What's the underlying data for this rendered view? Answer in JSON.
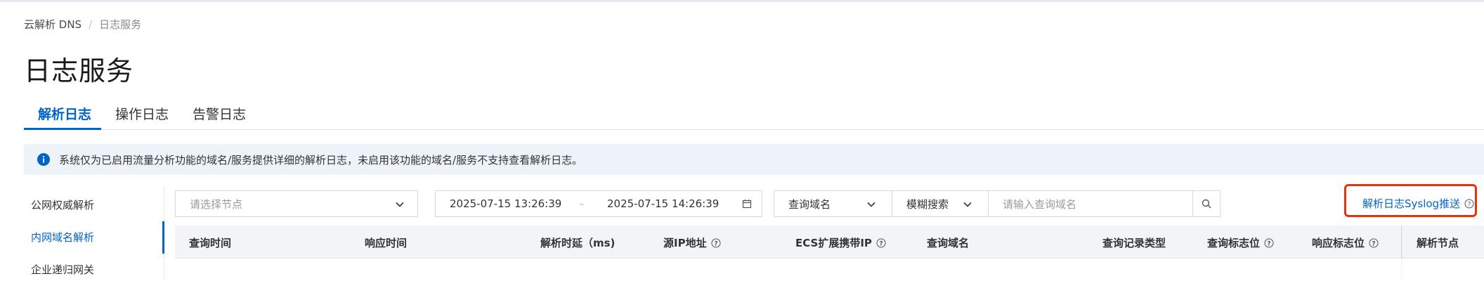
{
  "breadcrumb": {
    "root": "云解析 DNS",
    "separator": "/",
    "current": "日志服务"
  },
  "page": {
    "title": "日志服务"
  },
  "tabs": [
    {
      "label": "解析日志",
      "active": true
    },
    {
      "label": "操作日志",
      "active": false
    },
    {
      "label": "告警日志",
      "active": false
    }
  ],
  "notice": {
    "icon": "info-circle-icon",
    "text": "系统仅为已启用流量分析功能的域名/服务提供详细的解析日志，未启用该功能的域名/服务不支持查看解析日志。"
  },
  "sidebar": {
    "items": [
      {
        "label": "公网权威解析",
        "active": false
      },
      {
        "label": "内网域名解析",
        "active": true
      },
      {
        "label": "企业递归网关",
        "active": false
      }
    ]
  },
  "filters": {
    "node_select": {
      "placeholder": "请选择节点"
    },
    "date_range": {
      "start": "2025-07-15 13:26:39",
      "end": "2025-07-15 14:26:39"
    },
    "field_select": {
      "value": "查询域名"
    },
    "match_select": {
      "value": "模糊搜索"
    },
    "search_input": {
      "placeholder": "请输入查询域名"
    }
  },
  "syslog_link": {
    "label": "解析日志Syslog推送"
  },
  "table": {
    "columns": [
      {
        "label": "查询时间",
        "help": false
      },
      {
        "label": "响应时间",
        "help": false
      },
      {
        "label": "解析时延（ms)",
        "help": false
      },
      {
        "label": "源IP地址",
        "help": true
      },
      {
        "label": "ECS扩展携带IP",
        "help": true
      },
      {
        "label": "查询域名",
        "help": false
      },
      {
        "label": "查询记录类型",
        "help": false
      },
      {
        "label": "查询标志位",
        "help": true
      },
      {
        "label": "响应标志位",
        "help": true
      },
      {
        "label": "解析节点",
        "help": false
      }
    ]
  },
  "colors": {
    "accent": "#0064c8",
    "highlight_border": "#e8320e",
    "notice_bg": "#eef3fa",
    "header_bg": "#f2f4f7"
  }
}
